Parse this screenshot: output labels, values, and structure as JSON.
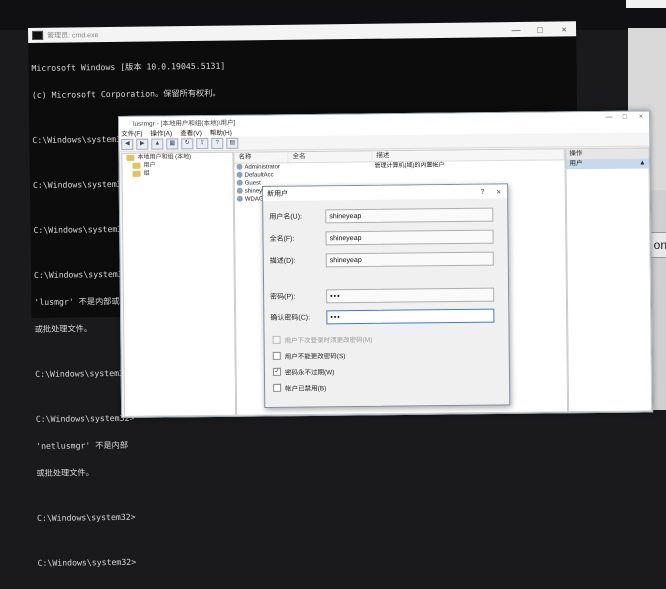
{
  "cmd": {
    "title": "管理员: cmd.exe",
    "controls": [
      "—",
      "□",
      "×"
    ],
    "lines": [
      "Microsoft Windows [版本 10.0.19045.5131]",
      "(c) Microsoft Corporation。保留所有权利。",
      "",
      "C:\\Windows\\system32>netplwiz",
      "",
      "C:\\Windows\\system32>regedit",
      "",
      "C:\\Windows\\system32>netplwiz",
      "",
      "C:\\Windows\\system32>",
      "'lusmgr' 不是内部或",
      "或批处理文件。",
      "",
      "C:\\Windows\\system32>",
      "",
      "C:\\Windows\\system32>",
      "'netlusmgr' 不是内部",
      "或批处理文件。",
      "",
      "C:\\Windows\\system32>",
      "",
      "C:\\Windows\\system32>"
    ]
  },
  "mmc": {
    "title": "lusrmgr - [本地用户和组(本地)\\用户]",
    "controls": [
      "—",
      "□",
      "×"
    ],
    "menu": [
      "文件(F)",
      "操作(A)",
      "查看(V)",
      "帮助(H)"
    ],
    "tree": {
      "root": "本地用户和组 (本地)",
      "items": [
        "用户",
        "组"
      ]
    },
    "list": {
      "columns": [
        "名称",
        "全名",
        "描述"
      ],
      "rows": [
        {
          "name": "Administrator",
          "full": "",
          "desc": "管理计算机(域)的内置帐户"
        },
        {
          "name": "DefaultAcc",
          "full": "",
          "desc": ""
        },
        {
          "name": "Guest",
          "full": "",
          "desc": ""
        },
        {
          "name": "shineye",
          "full": "",
          "desc": ""
        },
        {
          "name": "WDAG",
          "full": "",
          "desc": ""
        }
      ]
    },
    "actions": {
      "header": "操作",
      "selected": "用户",
      "arrow": "▲"
    }
  },
  "dialog": {
    "title": "新用户",
    "help": "?",
    "close": "×",
    "username_label": "用户名(U):",
    "username_value": "shineyeap",
    "fullname_label": "全名(F):",
    "fullname_value": "shineyeap",
    "desc_label": "描述(D):",
    "desc_value": "shineyeap",
    "password_label": "密码(P):",
    "password_value": "•••",
    "confirm_label": "确认密码(C):",
    "confirm_value": "•••",
    "options": [
      {
        "label": "用户下次登录时须更改密码(M)",
        "checked": false,
        "disabled": true
      },
      {
        "label": "用户不能更改密码(S)",
        "checked": false,
        "disabled": false
      },
      {
        "label": "密码永不过期(W)",
        "checked": true,
        "disabled": false
      },
      {
        "label": "帐户已禁用(B)",
        "checked": false,
        "disabled": false
      }
    ]
  },
  "background": {
    "right_button_text": "on"
  }
}
